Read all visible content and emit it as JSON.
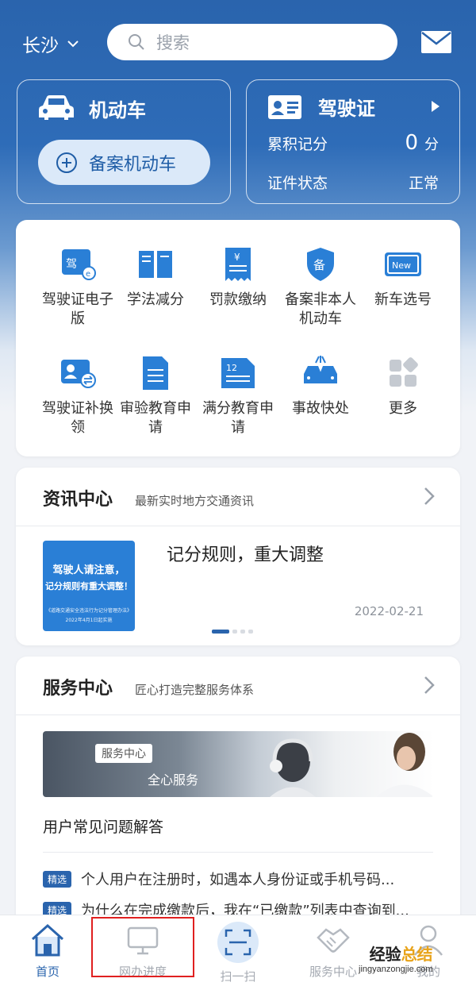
{
  "header": {
    "city": "长沙",
    "search_placeholder": "搜索"
  },
  "vehicle_card": {
    "title": "机动车",
    "register_button": "备案机动车"
  },
  "license_card": {
    "title": "驾驶证",
    "points_label": "累积记分",
    "points_value": "0",
    "points_unit": "分",
    "status_label": "证件状态",
    "status_value": "正常"
  },
  "services": [
    {
      "label": "驾驶证电子版",
      "icon": "e-license-icon"
    },
    {
      "label": "学法减分",
      "icon": "book-icon"
    },
    {
      "label": "罚款缴纳",
      "icon": "receipt-icon"
    },
    {
      "label": "备案非本人机动车",
      "icon": "shield-icon"
    },
    {
      "label": "新车选号",
      "icon": "new-plate-icon"
    },
    {
      "label": "驾驶证补换领",
      "icon": "id-swap-icon"
    },
    {
      "label": "审验教育申请",
      "icon": "document-icon"
    },
    {
      "label": "满分教育申请",
      "icon": "calendar-doc-icon"
    },
    {
      "label": "事故快处",
      "icon": "accident-icon"
    },
    {
      "label": "更多",
      "icon": "more-grid-icon"
    }
  ],
  "news": {
    "title": "资讯中心",
    "subtitle": "最新实时地方交通资讯",
    "thumb_line1": "驾驶人请注意，",
    "thumb_line2": "记分规则有重大调整！",
    "thumb_line3": "《道路交通安全违法行为记分管理办法》",
    "thumb_line4": "2022年4月1日起实施",
    "headline": "记分规则，重大调整",
    "date": "2022-02-21"
  },
  "service_center": {
    "title": "服务中心",
    "subtitle": "匠心打造完整服务体系",
    "banner_tag": "服务中心",
    "banner_sub": "全心服务",
    "faq_title": "用户常见问题解答",
    "faq_badge": "精选",
    "faqs": [
      "个人用户在注册时，如遇本人身份证或手机号码...",
      "为什么在完成缴款后，我在“已缴款”列表中查询到..."
    ]
  },
  "tabs": [
    {
      "label": "首页",
      "icon": "home-icon",
      "active": true
    },
    {
      "label": "网办进度",
      "icon": "monitor-icon",
      "active": false
    },
    {
      "label": "扫一扫",
      "icon": "scan-icon",
      "active": false
    },
    {
      "label": "服务中心",
      "icon": "handshake-icon",
      "active": false
    },
    {
      "label": "我的",
      "icon": "user-icon",
      "active": false
    }
  ],
  "watermark": {
    "line1a": "经验",
    "line1b": "总结",
    "line2": "jingyanzongjie.com"
  },
  "colors": {
    "primary": "#2a64ad",
    "highlight_box": "#e02020"
  }
}
